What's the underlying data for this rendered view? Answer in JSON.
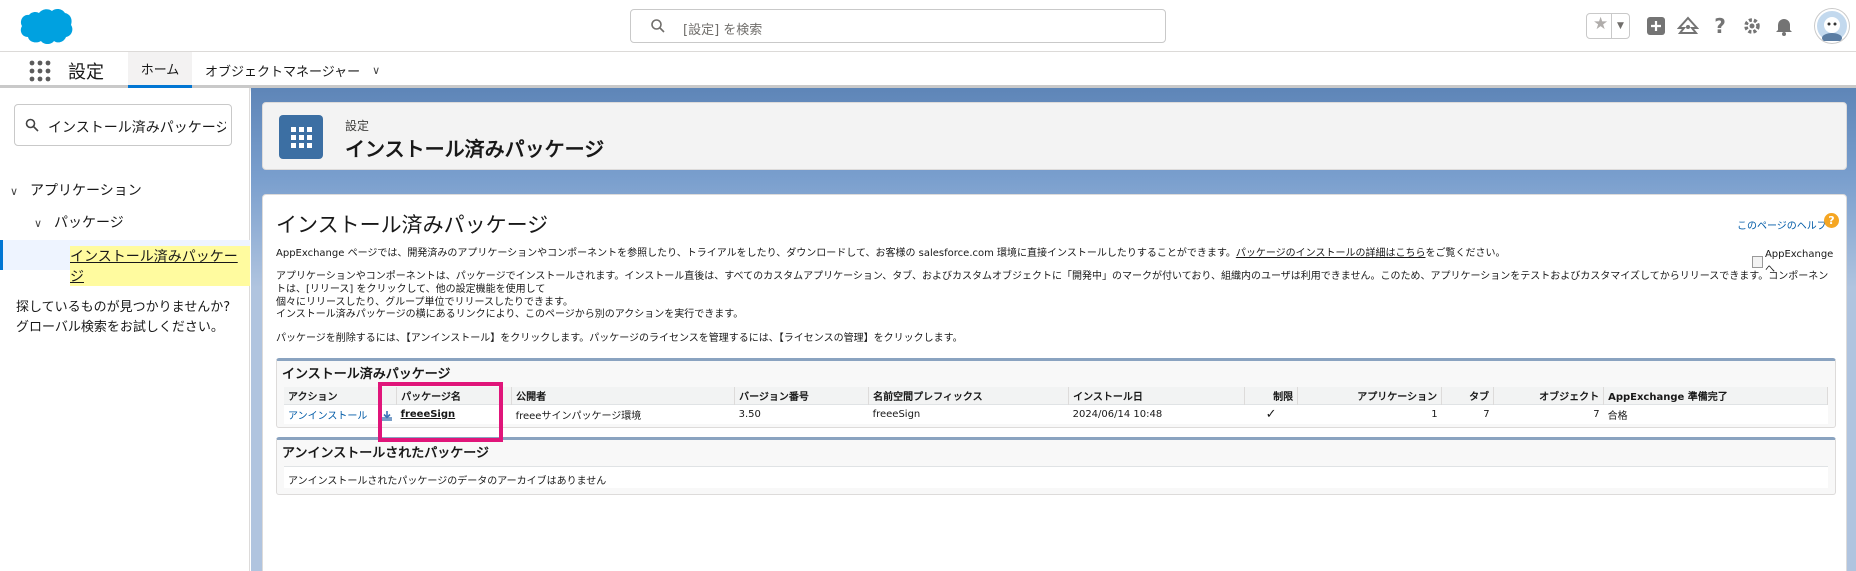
{
  "header": {
    "search_placeholder": "[設定] を検索",
    "icons": [
      "favorites-star-icon",
      "favorites-dropdown-icon",
      "global-actions-plus-icon",
      "trailhead-icon",
      "help-icon",
      "setup-gear-icon",
      "notifications-bell-icon",
      "user-avatar"
    ]
  },
  "nav": {
    "app_name": "設定",
    "tabs": [
      {
        "label": "ホーム",
        "active": true
      },
      {
        "label": "オブジェクトマネージャー"
      }
    ]
  },
  "sidebar": {
    "quick_find_value": "インストール済みパッケージ",
    "tree": {
      "level1": "アプリケーション",
      "level2": "パッケージ",
      "level3": "インストール済みパッケージ"
    },
    "help_line1": "探しているものが見つかりませんか?",
    "help_line2": "グローバル検索をお試しください。"
  },
  "page_header": {
    "breadcrumb": "設定",
    "title": "インストール済みパッケージ"
  },
  "content": {
    "title": "インストール済みパッケージ",
    "help_link": "このページのヘルプ",
    "help_icon": "?",
    "intro_text": "AppExchange ページでは、開発済みのアプリケーションやコンポーネントを参照したり、トライアルをしたり、ダウンロードして、お客様の salesforce.com 環境に直接インストールしたりすることができます。",
    "intro_link": "パッケージのインストールの詳細はこちら",
    "intro_suffix": "をご覧ください。",
    "appexchange_image_alt": "AppExchange へ",
    "para2_line1": "アプリケーションやコンポーネントは、パッケージでインストールされます。インストール直後は、すべてのカスタムアプリケーション、タブ、およびカスタムオブジェクトに「開発中」のマークが付いており、組織内のユーザは利用できません。このため、アプリケーションをテストおよびカスタマイズしてからリリースできます。コンポーネントは、[リリース] をクリックして、他の設定機能を使用して",
    "para2_line2": "個々にリリースしたり、グループ単位でリリースしたりできます。",
    "para3": "インストール済みパッケージの横にあるリンクにより、このページから別のアクションを実行できます。",
    "para4": "パッケージを削除するには、【アンインストール】をクリックします。パッケージのライセンスを管理するには、【ライセンスの管理】をクリックします。"
  },
  "installed_panel": {
    "title": "インストール済みパッケージ",
    "columns": [
      "アクション",
      "パッケージ名",
      "公開者",
      "バージョン番号",
      "名前空間プレフィックス",
      "インストール日",
      "制限",
      "アプリケーション",
      "タブ",
      "オブジェクト",
      "AppExchange 準備完了"
    ],
    "rows": [
      {
        "action": "アンインストール",
        "package_name": "freeeSign",
        "publisher": "freeeサインパッケージ環境",
        "version": "3.50",
        "namespace": "freeeSign",
        "install_date": "2024/06/14 10:48",
        "restricted": "✓",
        "apps": "1",
        "tabs": "7",
        "objects": "7",
        "appexchange_ready": "合格"
      }
    ]
  },
  "uninstalled_panel": {
    "title": "アンインストールされたパッケージ",
    "empty_message": "アンインストールされたパッケージのデータのアーカイブはありません"
  },
  "colors": {
    "brand_blue": "#0176d3",
    "header_tile": "#3c6fa3",
    "highlight_box": "#e0157a",
    "selected_yellow": "#fffb9f"
  }
}
